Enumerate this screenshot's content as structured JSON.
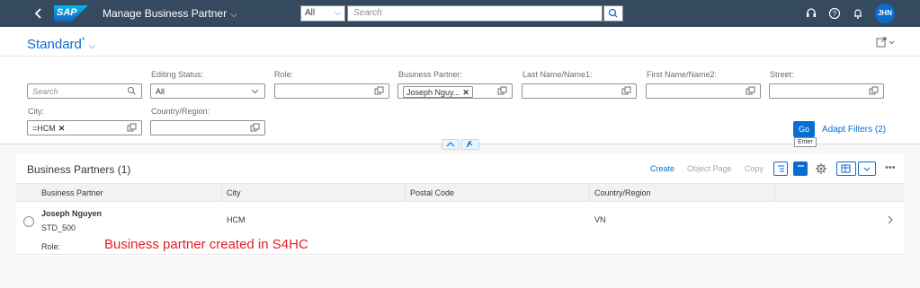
{
  "shell": {
    "logo_text": "SAP",
    "app_title": "Manage Business Partner",
    "scope_value": "All",
    "search_placeholder": "Search",
    "avatar_initials": "JHN",
    "colors": {
      "shell_bg": "#354a5f",
      "accent": "#0a6ed1",
      "avatar_bg": "#0a6ed1"
    },
    "icons": [
      "back-icon",
      "chevron-down-icon",
      "search-icon",
      "headset-icon",
      "help-icon",
      "bell-icon"
    ]
  },
  "header": {
    "variant_name": "Standard",
    "variant_modified_marker": "*",
    "icons": [
      "share-icon",
      "chevron-down-icon"
    ]
  },
  "filters": {
    "search_placeholder": "Search",
    "editing_status": {
      "label": "Editing Status:",
      "value": "All"
    },
    "role": {
      "label": "Role:",
      "value": ""
    },
    "business_partner": {
      "label": "Business Partner:",
      "token": "Joseph Nguy..."
    },
    "last_name": {
      "label": "Last Name/Name1:",
      "value": ""
    },
    "first_name": {
      "label": "First Name/Name2:",
      "value": ""
    },
    "street": {
      "label": "Street:",
      "value": ""
    },
    "city": {
      "label": "City:",
      "token": "=HCM"
    },
    "country_region": {
      "label": "Country/Region:",
      "value": ""
    },
    "go_label": "Go",
    "go_tooltip": "Enter",
    "adapt_filters_label": "Adapt Filters (2)"
  },
  "table": {
    "title": "Business Partners (1)",
    "actions": {
      "create": "Create",
      "object_page": "Object Page",
      "copy": "Copy"
    },
    "columns": [
      "Business Partner",
      "City",
      "Postal Code",
      "Country/Region"
    ],
    "rows": [
      {
        "name": "Joseph Nguyen",
        "id": "STD_500",
        "role_label": "Role:",
        "city": "HCM",
        "postal_code": "",
        "country_region": "VN"
      }
    ]
  },
  "annotation": "Business partner created in S4HC"
}
